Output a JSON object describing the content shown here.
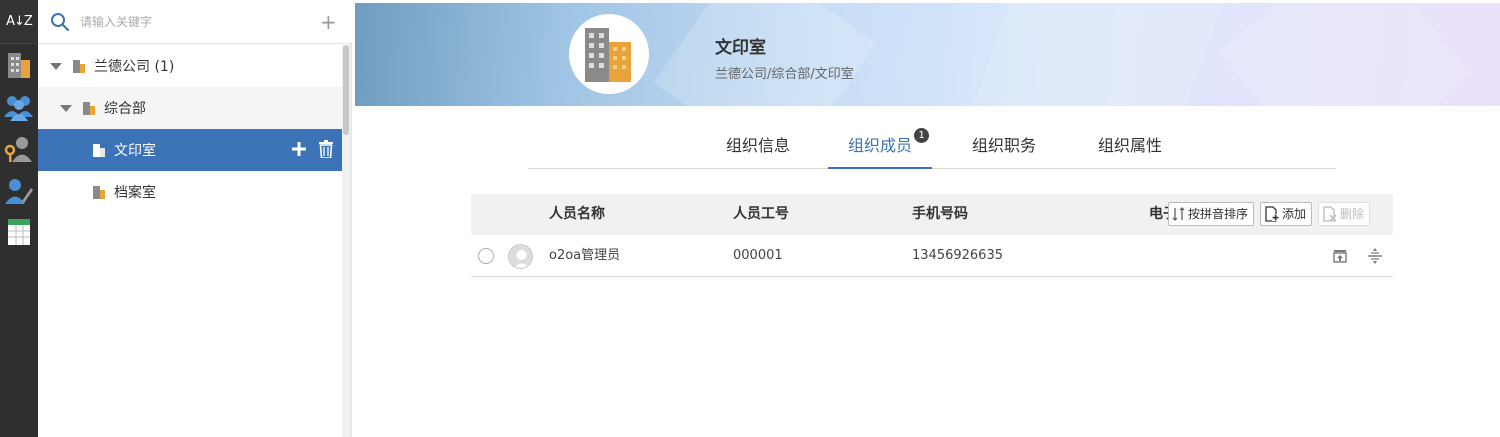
{
  "sidebar": {
    "sort_label": "A↓Z"
  },
  "tree": {
    "search_placeholder": "请输入关键字",
    "add_symbol": "+",
    "nodes": [
      {
        "label": "兰德公司 (1)"
      },
      {
        "label": "综合部"
      },
      {
        "label": "文印室"
      },
      {
        "label": "档案室"
      }
    ]
  },
  "header": {
    "title": "文印室",
    "path": "兰德公司/综合部/文印室"
  },
  "tabs": [
    {
      "label": "组织信息"
    },
    {
      "label": "组织成员",
      "badge": "1"
    },
    {
      "label": "组织职务"
    },
    {
      "label": "组织属性"
    }
  ],
  "table": {
    "columns": [
      "人员名称",
      "人员工号",
      "手机号码",
      "电子"
    ],
    "tools": {
      "sort_label": "按拼音排序",
      "add_label": "添加",
      "delete_label": "删除"
    },
    "rows": [
      {
        "name": "o2oa管理员",
        "employee_no": "000001",
        "phone": "13456926635"
      }
    ]
  },
  "colors": {
    "accent": "#3b73b6",
    "rail_bg": "#2f2f2f"
  }
}
